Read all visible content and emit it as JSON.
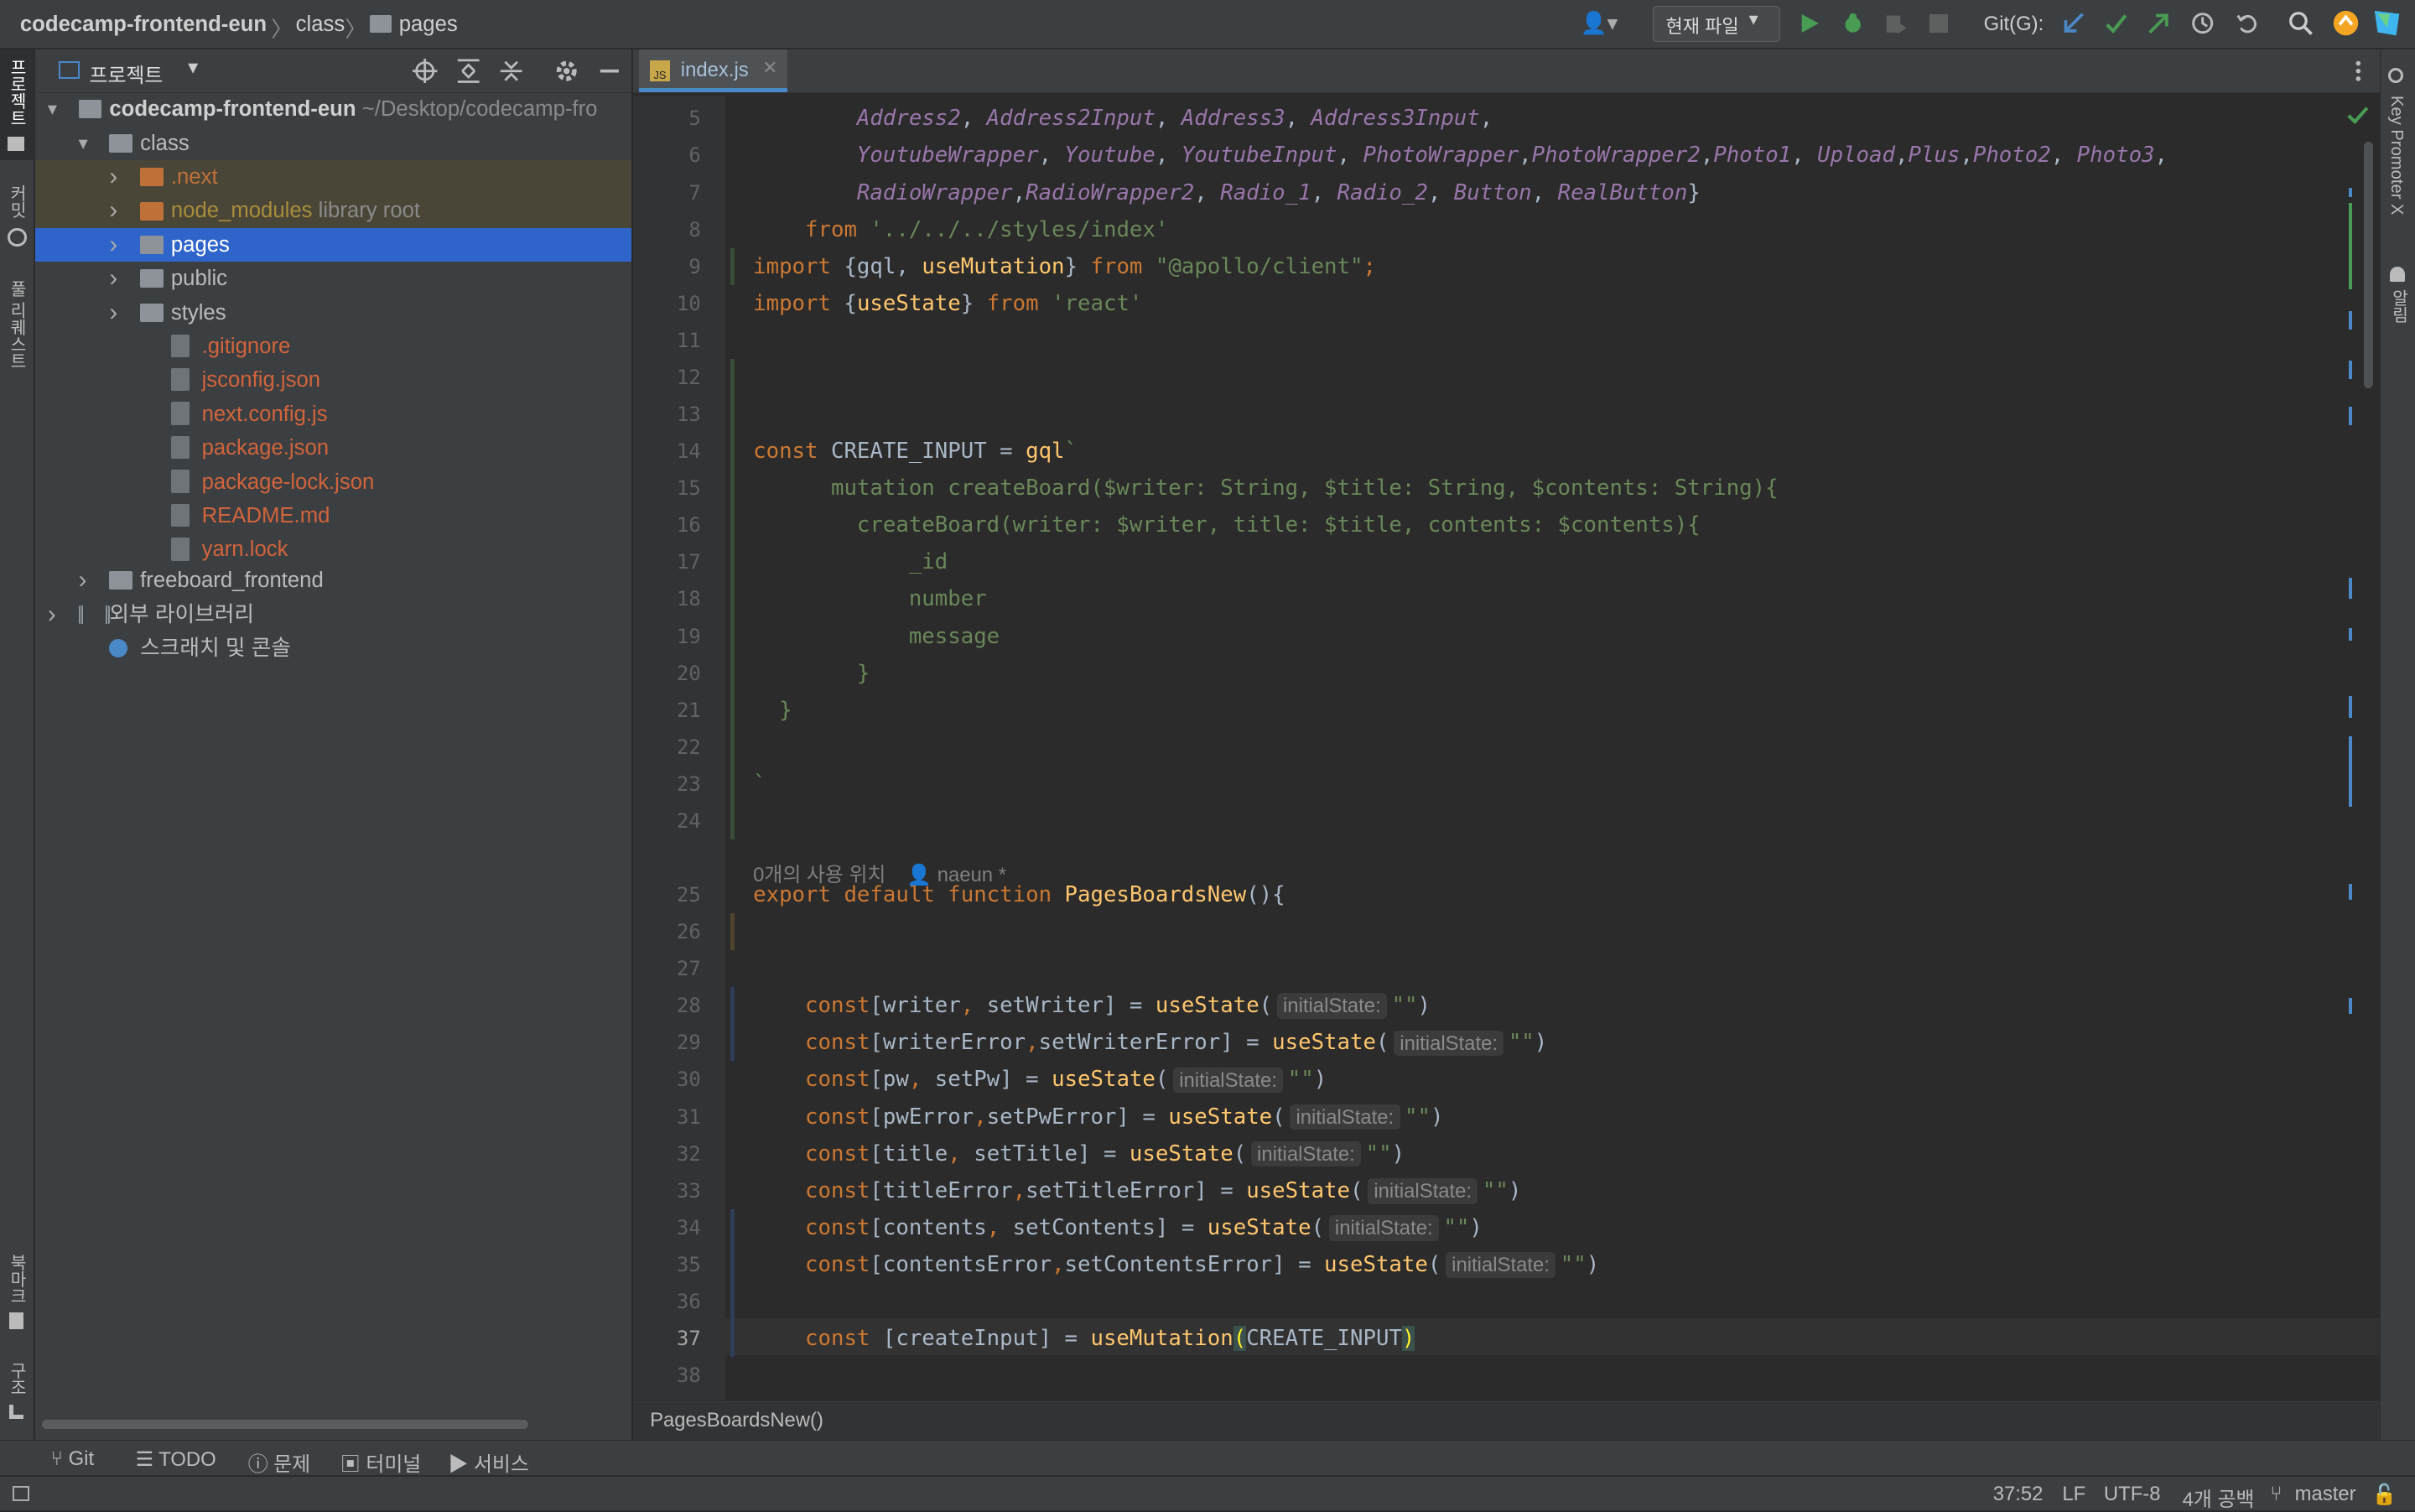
{
  "breadcrumb": {
    "project": "codecamp-frontend-eun",
    "sep": "〉",
    "folder1": "class",
    "folder2": "pages"
  },
  "topbar": {
    "run_config": "현재 파일",
    "git_label": "Git(G):"
  },
  "left_strip": {
    "project": "프로젝트",
    "commit": "커밋",
    "pull_requests": "풀 리퀘스트",
    "bookmarks": "북마크",
    "structure": "구조"
  },
  "right_strip": {
    "key_promoter": "Key Promoter X",
    "notifications": "알림"
  },
  "project_panel": {
    "title": "프로젝트",
    "tree": [
      {
        "label": "codecamp-frontend-eun",
        "suffix": "~/Desktop/codecamp-fro",
        "type": "folder",
        "expanded": true,
        "bold": true,
        "color": "#d0d0d0"
      },
      {
        "label": "class",
        "type": "folder",
        "expanded": true,
        "color": "#bbbbbb"
      },
      {
        "label": ".next",
        "type": "folder-orange",
        "expanded": false,
        "color": "#c0713a"
      },
      {
        "label": "node_modules",
        "suffix": "library root",
        "type": "folder-orange",
        "expanded": false,
        "color": "#a88d3a"
      },
      {
        "label": "pages",
        "type": "folder",
        "expanded": false,
        "color": "#ffffff"
      },
      {
        "label": "public",
        "type": "folder",
        "expanded": false,
        "color": "#bbbbbb"
      },
      {
        "label": "styles",
        "type": "folder",
        "expanded": false,
        "color": "#bbbbbb"
      },
      {
        "label": ".gitignore",
        "type": "file",
        "color": "#d2643c"
      },
      {
        "label": "jsconfig.json",
        "type": "file",
        "color": "#d2643c"
      },
      {
        "label": "next.config.js",
        "type": "file",
        "color": "#d2643c"
      },
      {
        "label": "package.json",
        "type": "file",
        "color": "#d2643c"
      },
      {
        "label": "package-lock.json",
        "type": "file",
        "color": "#d2643c"
      },
      {
        "label": "README.md",
        "type": "file",
        "color": "#d2643c"
      },
      {
        "label": "yarn.lock",
        "type": "file",
        "color": "#d2643c"
      },
      {
        "label": "freeboard_frontend",
        "type": "folder",
        "expanded": false,
        "color": "#bbbbbb"
      },
      {
        "label": "외부 라이브러리",
        "type": "lib",
        "expanded": false,
        "color": "#bbbbbb"
      },
      {
        "label": "스크래치 및 콘솔",
        "type": "scratch",
        "color": "#bbbbbb"
      }
    ]
  },
  "editor": {
    "tab_label": "index.js",
    "usages": "0개의 사용 위치",
    "author": "naeun *",
    "footer_breadcrumb": "PagesBoardsNew()",
    "line_numbers": [
      "5",
      "6",
      "7",
      "8",
      "9",
      "10",
      "11",
      "12",
      "13",
      "14",
      "15",
      "16",
      "17",
      "18",
      "19",
      "20",
      "21",
      "22",
      "23",
      "24",
      "25",
      "26",
      "27",
      "28",
      "29",
      "30",
      "31",
      "32",
      "33",
      "34",
      "35",
      "36",
      "37",
      "38"
    ],
    "current_line": "37",
    "hint_label": "initialState:"
  },
  "tool_windows": {
    "git": "Git",
    "todo": "TODO",
    "problems": "문제",
    "terminal": "터미널",
    "services": "서비스"
  },
  "status": {
    "position": "37:52",
    "line_sep": "LF",
    "encoding": "UTF-8",
    "indent": "4개 공백",
    "branch": "master"
  }
}
